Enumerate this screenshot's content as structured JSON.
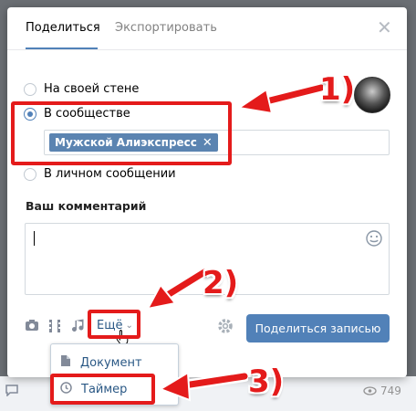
{
  "tabs": {
    "share": "Поделиться",
    "export": "Экспортировать"
  },
  "share_options": [
    {
      "label": "На своей стене",
      "checked": false
    },
    {
      "label": "В сообществе",
      "checked": true
    },
    {
      "label": "В личном сообщении",
      "checked": false
    }
  ],
  "community_tag": "Мужской Алиэкспресс",
  "comment_label": "Ваш комментарий",
  "toolbar": {
    "more_label": "Ещё",
    "share_button": "Поделиться записью"
  },
  "dropdown": [
    {
      "label": "Документ",
      "icon": "document-icon"
    },
    {
      "label": "Таймер",
      "icon": "clock-icon"
    }
  ],
  "annotations": [
    "1)",
    "2)",
    "3)"
  ],
  "background": {
    "views": "749"
  },
  "colors": {
    "accent": "#5181b8",
    "annotation": "#e41b1b"
  }
}
